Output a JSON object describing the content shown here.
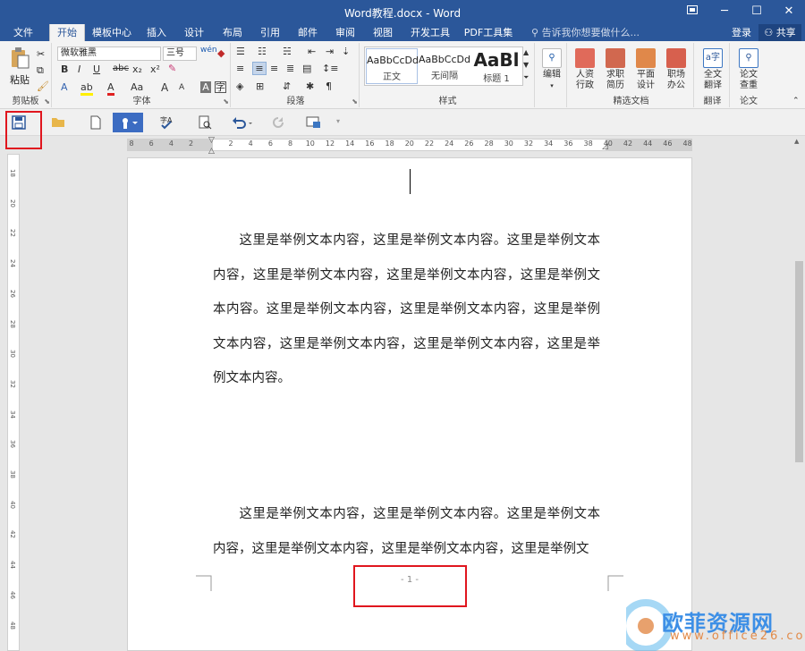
{
  "window": {
    "title": "Word教程.docx - Word",
    "restore_icon": "restore-icon"
  },
  "tabs": [
    "文件",
    "开始",
    "模板中心",
    "插入",
    "设计",
    "布局",
    "引用",
    "邮件",
    "审阅",
    "视图",
    "开发工具",
    "PDF工具集"
  ],
  "tellme": {
    "placeholder": "告诉我你想要做什么..."
  },
  "account": {
    "login": "登录",
    "share": "共享"
  },
  "ribbon": {
    "clipboard": {
      "label": "剪贴板",
      "paste": "粘贴"
    },
    "font": {
      "label": "字体",
      "name": "微软雅黑",
      "size": "三号",
      "bold": "B",
      "italic": "I",
      "underline": "U",
      "strike": "abc",
      "sub": "x₂",
      "sup": "x²",
      "fontcolor_a": "A",
      "aa": "Aa",
      "grow": "A",
      "shrink": "A"
    },
    "paragraph": {
      "label": "段落"
    },
    "styles": {
      "label": "样式",
      "items": [
        {
          "preview": "AaBbCcDd",
          "name": "正文"
        },
        {
          "preview": "AaBbCcDd",
          "name": "无间隔"
        },
        {
          "preview": "AaBl",
          "name": "标题 1"
        }
      ]
    },
    "editing": {
      "label": "编辑"
    },
    "templates": {
      "label": "精选文档",
      "items": [
        "人资\n行政",
        "求职\n简历",
        "平面\n设计",
        "职场\n办公"
      ]
    },
    "translate": {
      "label": "翻译",
      "button": "全文\n翻译"
    },
    "paper": {
      "label": "论文",
      "button": "论文\n查重"
    }
  },
  "ruler": {
    "ticks": [
      "8",
      "6",
      "4",
      "2",
      "",
      "2",
      "4",
      "6",
      "8",
      "10",
      "12",
      "14",
      "16",
      "18",
      "20",
      "22",
      "24",
      "26",
      "28",
      "30",
      "32",
      "34",
      "36",
      "38",
      "40",
      "42",
      "44",
      "46",
      "48"
    ],
    "vticks": [
      "18",
      "20",
      "22",
      "24",
      "26",
      "28",
      "30",
      "32",
      "34",
      "36",
      "38",
      "40",
      "42",
      "44",
      "46",
      "48"
    ]
  },
  "document": {
    "paragraphs": [
      "这里是举例文本内容，这里是举例文本内容。这里是举例文本内容，这里是举例文本内容，这里是举例文本内容，这里是举例文本内容。这里是举例文本内容，这里是举例文本内容，这里是举例文本内容，这里是举例文本内容，这里是举例文本内容，这里是举例文本内容。",
      "这里是举例文本内容，这里是举例文本内容。这里是举例文本内容，这里是举例文本内容，这里是举例文本内容，这里是举例文"
    ],
    "page_number": "- 1 -"
  },
  "watermark": {
    "text": "欧菲资源网",
    "url": "www.office26.com"
  }
}
